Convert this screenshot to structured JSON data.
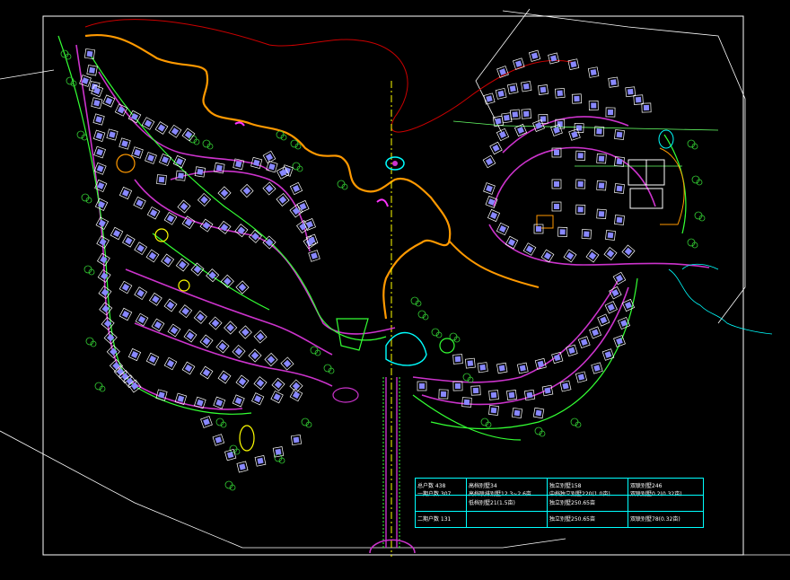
{
  "legend_table": {
    "rows": [
      [
        "总户数 438",
        "高档别墅34",
        "独立别墅158",
        "双联别墅246"
      ],
      [
        "一期户数 307",
        "高档联排别墅12.3~2.6亩",
        "中档独立别墅220(1.0亩)",
        "双联别墅0.2(0.32亩)"
      ],
      [
        "",
        "低档别墅21(1.5亩)",
        "独立别墅250.65亩",
        ""
      ],
      [
        "二期户数 131",
        "",
        "独立别墅250.65亩",
        "双联别墅78(0.32亩)"
      ]
    ]
  },
  "colors": {
    "background": "#000000",
    "road_purple": "#cc33cc",
    "path_green": "#33ff33",
    "trail_orange": "#ff9900",
    "boundary_red": "#cc0000",
    "villa_blue": "#8888ff",
    "table_cyan": "#00ffff",
    "axis_yellow": "#ffff00"
  }
}
